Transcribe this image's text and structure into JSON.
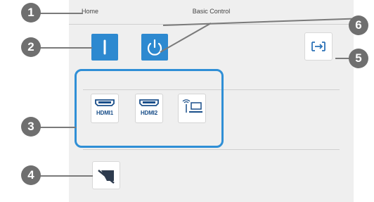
{
  "header": {
    "home_label": "Home",
    "title": "Basic Control"
  },
  "buttons": {
    "a_v_mute": "a-v-mute",
    "power": "power",
    "source_search": "source-search",
    "blank": "blank-screen"
  },
  "sources": [
    {
      "label": "HDMI1"
    },
    {
      "label": "HDMI2"
    },
    {
      "label": ""
    }
  ],
  "callouts": [
    "1",
    "2",
    "3",
    "4",
    "5",
    "6"
  ],
  "colors": {
    "accent": "#2d89d0",
    "callout": "#6f6f6f",
    "panel": "#efefef"
  }
}
